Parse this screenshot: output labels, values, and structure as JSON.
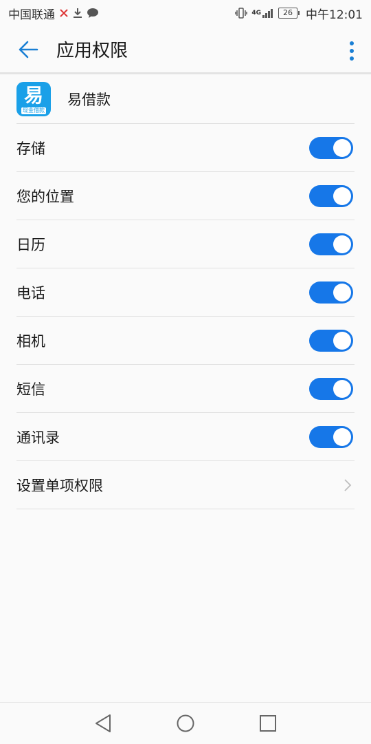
{
  "status_bar": {
    "carrier": "中国联通",
    "network": "4G",
    "battery": "26",
    "time": "中午12:01"
  },
  "header": {
    "title": "应用权限"
  },
  "app": {
    "name": "易借款",
    "icon_glyph": "易",
    "icon_sub": "现金借款",
    "icon_color": "#1aa0e8"
  },
  "permissions": [
    {
      "label": "存储",
      "enabled": true
    },
    {
      "label": "您的位置",
      "enabled": true
    },
    {
      "label": "日历",
      "enabled": true
    },
    {
      "label": "电话",
      "enabled": true
    },
    {
      "label": "相机",
      "enabled": true
    },
    {
      "label": "短信",
      "enabled": true
    },
    {
      "label": "通讯录",
      "enabled": true
    }
  ],
  "individual": {
    "label": "设置单项权限"
  },
  "colors": {
    "accent": "#1677e8",
    "back_arrow": "#1a7fd4"
  }
}
